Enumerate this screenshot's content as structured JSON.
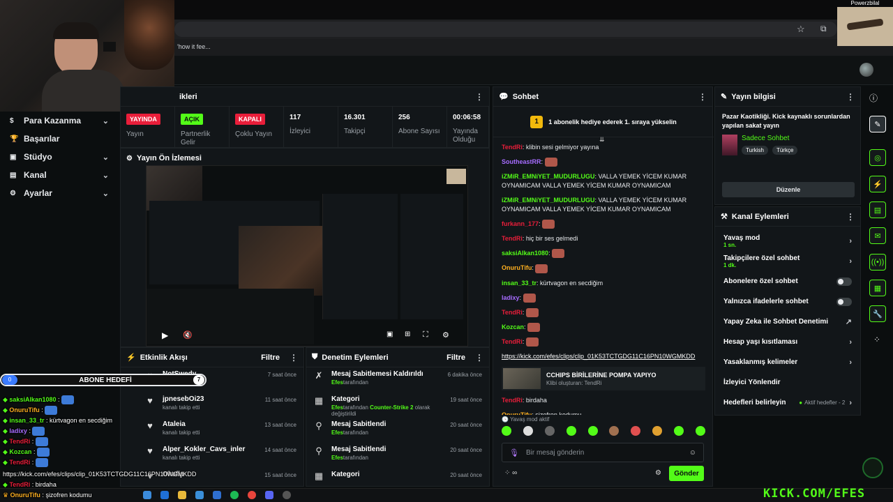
{
  "browser": {
    "bookmark_text": "'how it fee...",
    "star_icon": "star-icon",
    "extension_icon": "puzzle-icon"
  },
  "overlay_cam": {
    "name": "Powerzbilal"
  },
  "sidebar": {
    "items": [
      {
        "label": "Para Kazanma",
        "icon": "dollar-icon",
        "has_chevron": true
      },
      {
        "label": "Başarılar",
        "icon": "trophy-icon",
        "has_chevron": false
      },
      {
        "label": "Stüdyo",
        "icon": "studio-icon",
        "has_chevron": true
      },
      {
        "label": "Kanal",
        "icon": "channel-icon",
        "has_chevron": true
      },
      {
        "label": "Ayarlar",
        "icon": "gear-icon",
        "has_chevron": true
      }
    ]
  },
  "stats_panel": {
    "title_fragment": "ikleri",
    "stats": [
      {
        "badge": "YAYINDA",
        "badge_color": "#e91e3a",
        "label": "Yayın"
      },
      {
        "badge": "AÇIK",
        "badge_color": "#53fc18",
        "label": "Partnerlik Gelir"
      },
      {
        "badge": "KAPALI",
        "badge_color": "#e91e3a",
        "label": "Çoklu Yayın"
      },
      {
        "value": "117",
        "label": "İzleyici"
      },
      {
        "value": "16.301",
        "label": "Takipçi"
      },
      {
        "value": "256",
        "label": "Abone Sayısı"
      },
      {
        "value": "00:06:58",
        "label": "Yayında Olduğu"
      }
    ]
  },
  "preview": {
    "title": "Yayın Ön İzlemesi"
  },
  "events": {
    "title": "Etkinlik Akışı",
    "filter": "Filtre",
    "rows": [
      {
        "name": "NotSwedy",
        "sub": "kanalı takip etti",
        "time": "7 saat önce"
      },
      {
        "name": "jpnesebOi23",
        "sub": "kanalı takip etti",
        "time": "11 saat önce"
      },
      {
        "name": "Ataleia",
        "sub": "kanalı takip etti",
        "time": "13 saat önce"
      },
      {
        "name": "Alper_Kokler_Cavs_inler",
        "sub": "kanalı takip etti",
        "time": "14 saat önce"
      },
      {
        "name": "Okafip",
        "sub": "",
        "time": "15 saat önce"
      }
    ]
  },
  "moderation": {
    "title": "Denetim Eylemleri",
    "filter": "Filtre",
    "rows": [
      {
        "name": "Mesaj Sabitlemesi Kaldırıldı",
        "by": "Efes",
        "rest": "tarafından",
        "time": "6 dakika önce",
        "icon": "unpin-icon"
      },
      {
        "name": "Kategori",
        "by": "Efes",
        "rest": "tarafından",
        "highlight": "Counter-Strike 2",
        "rest2": "olarak değiştirildi",
        "time": "19 saat önce",
        "icon": "category-icon"
      },
      {
        "name": "Mesaj Sabitlendi",
        "by": "Efes",
        "rest": "tarafından",
        "time": "20 saat önce",
        "icon": "pin-icon"
      },
      {
        "name": "Mesaj Sabitlendi",
        "by": "Efes",
        "rest": "tarafından",
        "time": "20 saat önce",
        "icon": "pin-icon"
      },
      {
        "name": "Kategori",
        "by": "",
        "rest": "",
        "time": "20 saat önce",
        "icon": "category-icon"
      }
    ]
  },
  "chat": {
    "title": "Sohbet",
    "pinned_banner": "1 abonelik hediye ederek 1. sıraya yükselin",
    "pinned_rank": "1",
    "messages": [
      {
        "user": "TendRi",
        "color": "#e91e3a",
        "text": "klibin sesi gelmiyor yayına"
      },
      {
        "user": "SoutheastRR",
        "color": "#a66cff",
        "text": ""
      },
      {
        "user": "iZMiR_EMNiYET_MUDURLUGU",
        "color": "#53fc18",
        "text": "VALLA YEMEK YİCEM KUMAR OYNAMICAM VALLA YEMEK YİCEM KUMAR OYNAMICAM"
      },
      {
        "user": "iZMiR_EMNiYET_MUDURLUGU",
        "color": "#53fc18",
        "text": "VALLA YEMEK YİCEM KUMAR OYNAMICAM VALLA YEMEK YİCEM KUMAR OYNAMICAM"
      },
      {
        "user": "furkann_177",
        "color": "#e91e3a",
        "text": ""
      },
      {
        "user": "TendRi",
        "color": "#e91e3a",
        "text": "hiç bir ses gelmedi"
      },
      {
        "user": "saksiAlkan1080",
        "color": "#53fc18",
        "text": ""
      },
      {
        "user": "OnuruTifu",
        "color": "#ffb020",
        "text": ""
      },
      {
        "user": "insan_33_tr",
        "color": "#53fc18",
        "text": "kürtvagon en secdiğim"
      },
      {
        "user": "ladixy",
        "color": "#a66cff",
        "text": ""
      },
      {
        "user": "TendRi",
        "color": "#e91e3a",
        "text": ""
      },
      {
        "user": "Kozcan",
        "color": "#53fc18",
        "text": ""
      },
      {
        "user": "TendRi",
        "color": "#e91e3a",
        "text": ""
      }
    ],
    "link": "https://kick.com/efes/clips/clip_01K53TCTGDG11C16PN10WGMKDD",
    "clip_title": "CCHIPS BİRİLERİNE POMPA YAPIYO",
    "clip_by": "Klibi oluşturan: TendRi",
    "after": [
      {
        "user": "TendRi",
        "color": "#e91e3a",
        "text": "birdaha"
      },
      {
        "user": "OnuruTifu",
        "color": "#ffb020",
        "text": "şizofren kodumu"
      }
    ],
    "slow_mode": "Yavaş mod aktif",
    "placeholder": "Bir mesaj gönderin",
    "send": "Gönder"
  },
  "stream_info": {
    "title": "Yayın bilgisi",
    "stream_title": "Pazar Kaotikliği. Kick kaynaklı sorunlardan yapılan sakat yayın",
    "category": "Sadece Sohbet",
    "tags": [
      "Turkish",
      "Türkçe"
    ],
    "edit": "Düzenle"
  },
  "channel_actions": {
    "title": "Kanal Eylemleri",
    "rows": [
      {
        "label": "Yavaş mod",
        "sub": "1 sn.",
        "control": "chevron"
      },
      {
        "label": "Takipçilere özel sohbet",
        "sub": "1 dk.",
        "control": "chevron"
      },
      {
        "label": "Abonelere özel sohbet",
        "sub": "",
        "control": "toggle"
      },
      {
        "label": "Yalnızca ifadelerle sohbet",
        "sub": "",
        "control": "toggle"
      },
      {
        "label": "Yapay Zeka ile Sohbet Denetimi",
        "sub": "",
        "control": "external"
      },
      {
        "label": "Hesap yaşı kısıtlaması",
        "sub": "",
        "control": "chevron"
      },
      {
        "label": "Yasaklanmış kelimeler",
        "sub": "",
        "control": "chevron"
      },
      {
        "label": "İzleyici Yönlendir",
        "sub": "",
        "control": "none"
      },
      {
        "label": "Hedefleri belirleyin",
        "sub": "",
        "control": "goal",
        "goal_text": "Aktif hedefler - 2"
      }
    ]
  },
  "stream_overlay": {
    "goal_label": "ABONE HEDEFİ",
    "goal_current": "0",
    "goal_target": "7",
    "lines": [
      {
        "user": "saksiAlkan1080",
        "color": "#53fc18",
        "text": ""
      },
      {
        "user": "OnuruTifu",
        "color": "#ffb020",
        "text": ""
      },
      {
        "user": "insan_33_tr",
        "color": "#53fc18",
        "text": "kürtvagon en secdiğim"
      },
      {
        "user": "ladixy",
        "color": "#a66cff",
        "text": ""
      },
      {
        "user": "TendRi",
        "color": "#e91e3a",
        "text": ""
      },
      {
        "user": "Kozcan",
        "color": "#53fc18",
        "text": ""
      },
      {
        "user": "TendRi",
        "color": "#e91e3a",
        "text": ""
      }
    ],
    "link": "https://kick.com/efes/clips/clip_01K53TCTGDG11C16PN10WGMKDD",
    "line_after_user": "TendRi",
    "line_after_text": "birdaha",
    "last_user": "OnuruTifu",
    "last_text": "şizofren kodumu",
    "watermark": "KICK.COM/EFES"
  }
}
